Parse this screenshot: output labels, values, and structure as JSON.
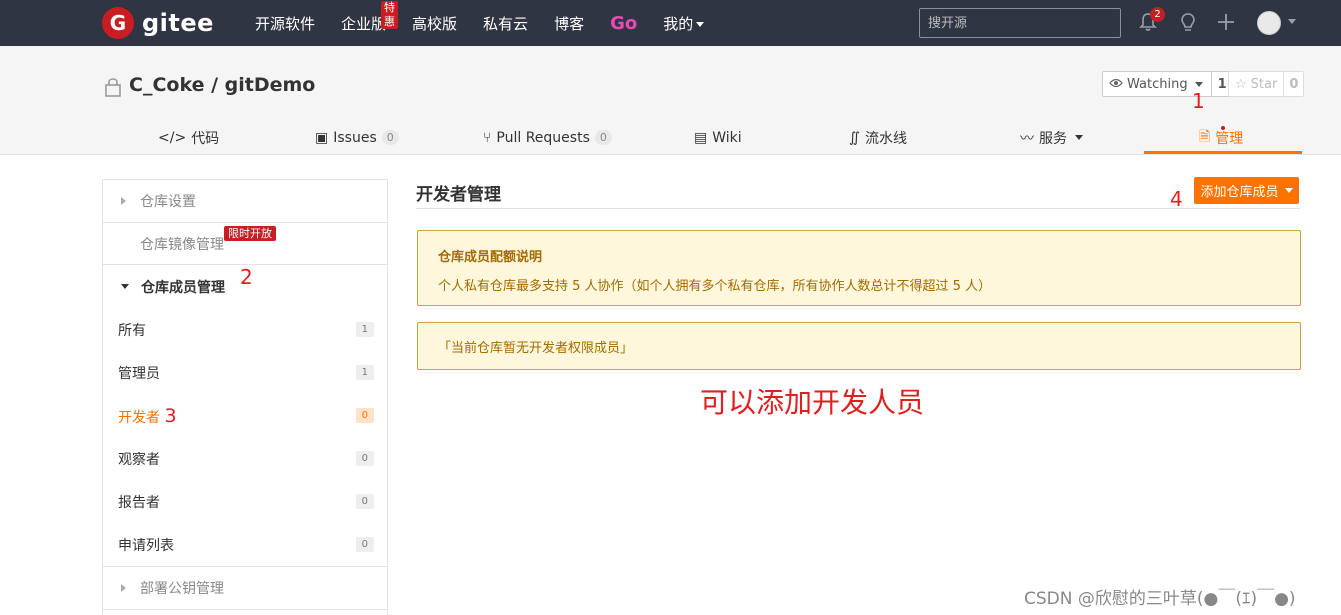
{
  "nav": {
    "logo_letter": "G",
    "logo_text": "gitee",
    "links": [
      "开源软件",
      "企业版",
      "高校版",
      "私有云",
      "博客"
    ],
    "enterprise_badge": "特惠",
    "go_label": "Go",
    "mine_label": "我的",
    "search_placeholder": "搜开源",
    "notification_count": "2"
  },
  "repo": {
    "title": "C_Coke / gitDemo",
    "watch_label": "Watching",
    "watch_count": "1",
    "star_label": "Star",
    "star_count": "0"
  },
  "tabs": [
    {
      "label": "代码",
      "icon": "code-icon"
    },
    {
      "label": "Issues",
      "count": "0",
      "icon": "issues-icon"
    },
    {
      "label": "Pull Requests",
      "count": "0",
      "icon": "pull-request-icon"
    },
    {
      "label": "Wiki",
      "icon": "wiki-icon"
    },
    {
      "label": "流水线",
      "icon": "pipeline-icon"
    },
    {
      "label": "服务",
      "icon": "service-icon"
    },
    {
      "label": "管理",
      "icon": "manage-icon",
      "active": true
    }
  ],
  "sidebar": {
    "repo_settings": "仓库设置",
    "mirror_manage": "仓库镜像管理",
    "limited_badge": "限时开放",
    "member_manage": "仓库成员管理",
    "items": [
      {
        "label": "所有",
        "count": "1"
      },
      {
        "label": "管理员",
        "count": "1"
      },
      {
        "label": "开发者",
        "count": "0",
        "active": true
      },
      {
        "label": "观察者",
        "count": "0"
      },
      {
        "label": "报告者",
        "count": "0"
      },
      {
        "label": "申请列表",
        "count": "0"
      }
    ],
    "deploy_keys": "部署公钥管理"
  },
  "main": {
    "title": "开发者管理",
    "add_button": "添加仓库成员",
    "notice_title": "仓库成员配额说明",
    "notice_text": "个人私有仓库最多支持 5 人协作（如个人拥有多个私有仓库，所有协作人数总计不得超过 5 人）",
    "empty_notice": "「当前仓库暂无开发者权限成员」"
  },
  "annotations": {
    "n1": "1",
    "n2": "2",
    "n3": "3",
    "n4": "4",
    "big": "可以添加开发人员"
  },
  "watermark": "CSDN @欣慰的三叶草(●￣(ｴ)￣●)",
  "colors": {
    "nav_bg": "#2f3542",
    "accent": "#fe7300",
    "brand_red": "#c71d23",
    "notice_bg": "#fff7dc",
    "annotation_red": "#e21e1e"
  }
}
